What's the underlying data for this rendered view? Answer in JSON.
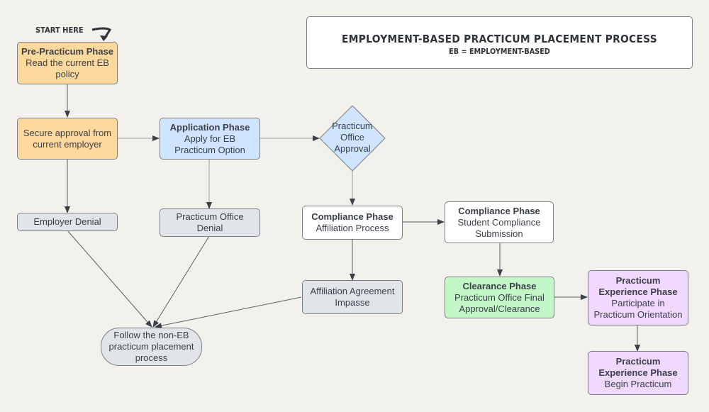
{
  "title": {
    "main": "EMPLOYMENT-BASED PRACTICUM PLACEMENT PROCESS",
    "sub": "EB = EMPLOYMENT-BASED"
  },
  "annotation": {
    "start_here": "START HERE"
  },
  "nodes": {
    "pre_practicum": {
      "title": "Pre-Practicum Phase",
      "text": "Read the current EB policy"
    },
    "secure_approval": {
      "text": "Secure approval from current employer"
    },
    "application": {
      "title": "Application Phase",
      "text": "Apply for EB Practicum Option"
    },
    "office_approval": {
      "text_lines": [
        "Practicum",
        "Office",
        "Approval"
      ]
    },
    "employer_denial": {
      "text": "Employer Denial"
    },
    "office_denial": {
      "text": "Practicum Office Denial"
    },
    "compliance_affiliation": {
      "title": "Compliance Phase",
      "text": "Affiliation Process"
    },
    "compliance_student": {
      "title": "Compliance Phase",
      "text": "Student Compliance Submission"
    },
    "affiliation_impasse": {
      "text": "Affiliation Agreement Impasse"
    },
    "clearance": {
      "title": "Clearance Phase",
      "text": "Practicum Office Final Approval/Clearance"
    },
    "experience_orientation": {
      "title": "Practicum Experience Phase",
      "text": "Participate in Practicum Orientation"
    },
    "experience_begin": {
      "title": "Practicum Experience Phase",
      "text": "Begin Practicum"
    },
    "non_eb": {
      "text": "Follow the non-EB practicum placement process"
    }
  },
  "colors": {
    "background": "#f2f1eb",
    "orange": "#fed99e",
    "blue": "#cfe4ff",
    "gray": "#e1e4e9",
    "green": "#c3f7c8",
    "purple": "#f1d8ff",
    "line": "#4a4e56"
  }
}
